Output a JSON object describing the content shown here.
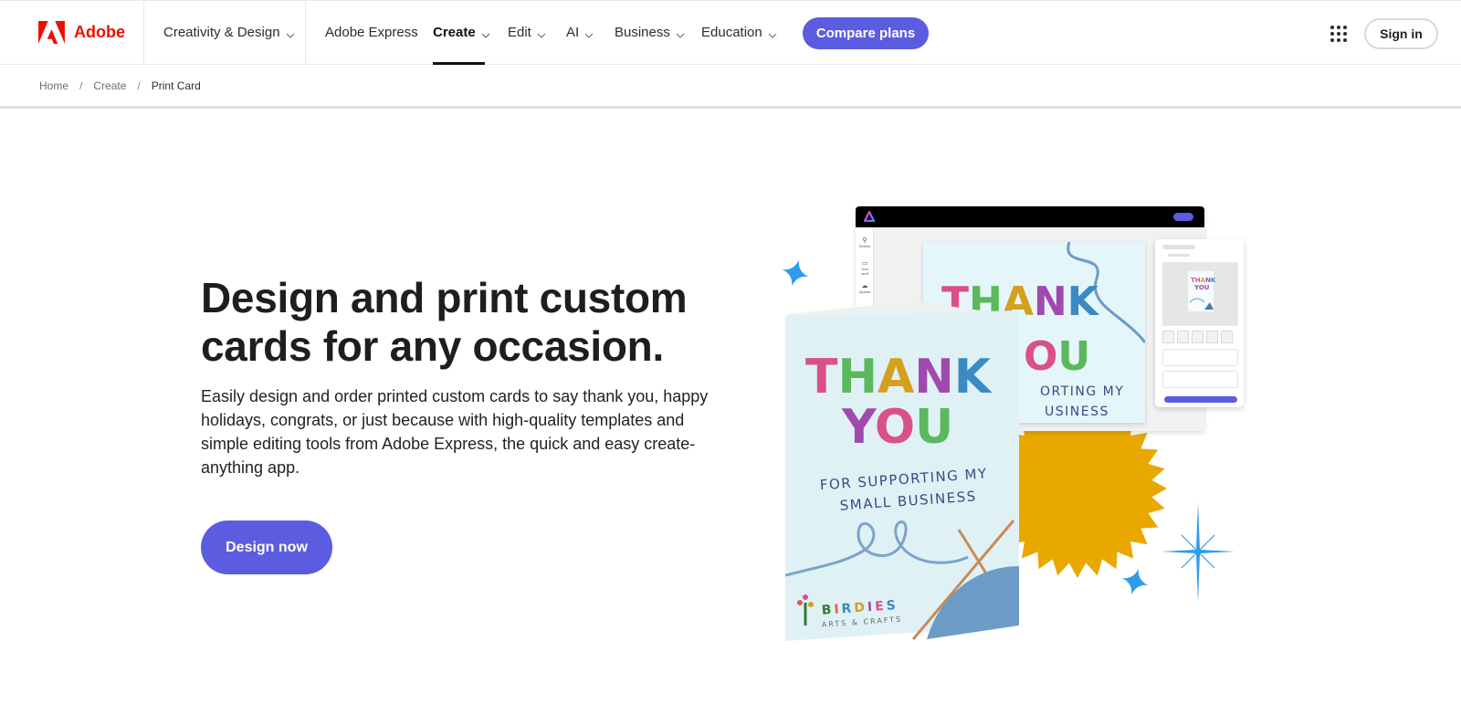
{
  "nav": {
    "brand": "Adobe",
    "items": [
      {
        "label": "Creativity & Design",
        "has_dropdown": true
      },
      {
        "label": "Adobe Express",
        "has_dropdown": false
      },
      {
        "label": "Create",
        "has_dropdown": true,
        "active": true
      },
      {
        "label": "Edit",
        "has_dropdown": true
      },
      {
        "label": "AI",
        "has_dropdown": true
      },
      {
        "label": "Business",
        "has_dropdown": true
      },
      {
        "label": "Education",
        "has_dropdown": true
      }
    ],
    "compare_plans": "Compare plans",
    "apps_icon": "app-grid-icon",
    "sign_in": "Sign in"
  },
  "breadcrumb": {
    "items": [
      "Home",
      "Create"
    ],
    "separator": "/",
    "current": "Print Card"
  },
  "hero": {
    "title": "Design and print custom cards for any occasion.",
    "description": "Easily design and order printed custom cards to say thank you, happy holidays, congrats, or just because with high-quality templates and simple editing tools from Adobe Express, the quick and easy create-anything app.",
    "cta": "Design now"
  },
  "illustration": {
    "card_headline_1": "THANK",
    "card_headline_2": "YOU",
    "card_subtitle_1": "FOR SUPPORTING MY",
    "card_subtitle_2": "SMALL BUSINESS",
    "card_back_sub_1": "ORTING MY",
    "card_back_sub_2": "USINESS",
    "card_brand": "BIRDIES",
    "card_brand_sub": "ARTS & CRAFTS",
    "rail_labels": [
      "Search",
      "Your stuff",
      "Upload"
    ]
  },
  "colors": {
    "accent": "#5c5ce0",
    "adobe_red": "#eb1000",
    "sunburst": "#e8a800",
    "sparkle": "#2d9cea"
  }
}
